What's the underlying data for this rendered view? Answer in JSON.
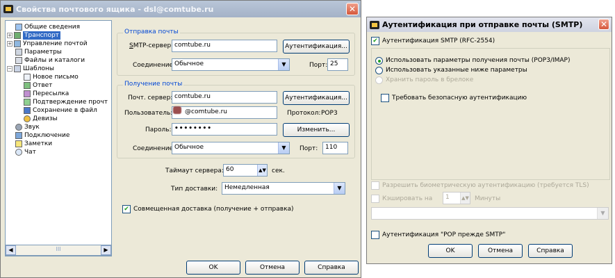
{
  "win1": {
    "title": "Свойства почтового ящика - dsl@comtube.ru",
    "tree": [
      {
        "label": "Общие сведения",
        "expander": ""
      },
      {
        "label": "Транспорт",
        "expander": "+"
      },
      {
        "label": "Управление почтой",
        "expander": "+"
      },
      {
        "label": "Параметры",
        "expander": ""
      },
      {
        "label": "Файлы и каталоги",
        "expander": ""
      },
      {
        "label": "Шаблоны",
        "expander": "−"
      },
      {
        "label": "Новое письмо",
        "expander": ""
      },
      {
        "label": "Ответ",
        "expander": ""
      },
      {
        "label": "Пересылка",
        "expander": ""
      },
      {
        "label": "Подтверждение прочт",
        "expander": ""
      },
      {
        "label": "Сохранение в файл",
        "expander": ""
      },
      {
        "label": "Девизы",
        "expander": ""
      },
      {
        "label": "Звук",
        "expander": ""
      },
      {
        "label": "Подключение",
        "expander": ""
      },
      {
        "label": "Заметки",
        "expander": ""
      },
      {
        "label": "Чат",
        "expander": ""
      }
    ],
    "scroll_mid": "III",
    "send": {
      "title": "Отправка почты",
      "smtp_label_u": "S",
      "smtp_label_rest": "MTP-сервер:",
      "smtp_value": "comtube.ru",
      "auth_button": "Аутентификация...",
      "conn_label": "Соединение:",
      "conn_value": "Обычное",
      "port_label": "Порт:",
      "port_value": "25"
    },
    "receive": {
      "title": "Получение почты",
      "server_label": "Почт. сервер:",
      "server_value": "comtube.ru",
      "auth_button": "Аутентификация...",
      "user_label": "Пользователь:",
      "user_value": "@comtube.ru",
      "protocol_label": "Протокол:",
      "protocol_value": "POP3",
      "pass_label": "Пароль:",
      "pass_value": "••••••••",
      "change_button": "Изменить...",
      "conn_label": "Соединение:",
      "conn_value": "Обычное",
      "port_label": "Порт:",
      "port_value": "110"
    },
    "timeout_label": "Таймаут сервера:",
    "timeout_value": "60",
    "timeout_unit": "сек.",
    "delivery_label": "Тип доставки:",
    "delivery_value": "Немедленная",
    "combined_label": "Совмещенная доставка (получение + отправка)",
    "ok": "OK",
    "cancel": "Отмена",
    "help": "Справка"
  },
  "win2": {
    "title": "Аутентификация при отправке почты (SMTP)",
    "smtp_auth_label": "Аутентификация SMTP (RFC-2554)",
    "radio1": "Использовать параметры получения почты (POP3/IMAP)",
    "radio2": "Использовать указанные ниже параметры",
    "store_pass": "Хранить пароль в брелоке",
    "secure_auth": "Требовать безопасную аутентификацию",
    "biometric": "Разрешить биометрическую аутентификацию (требуется TLS)",
    "cache_label": "Кэшировать на",
    "cache_value": "1",
    "cache_unit": "Минуты",
    "pop_before_smtp": "Аутентификация \"POP прежде SMTP\"",
    "ok": "OK",
    "cancel": "Отмена",
    "help": "Справка"
  },
  "colors": {
    "group_title": "#0046d5",
    "selection": "#316ac5"
  }
}
